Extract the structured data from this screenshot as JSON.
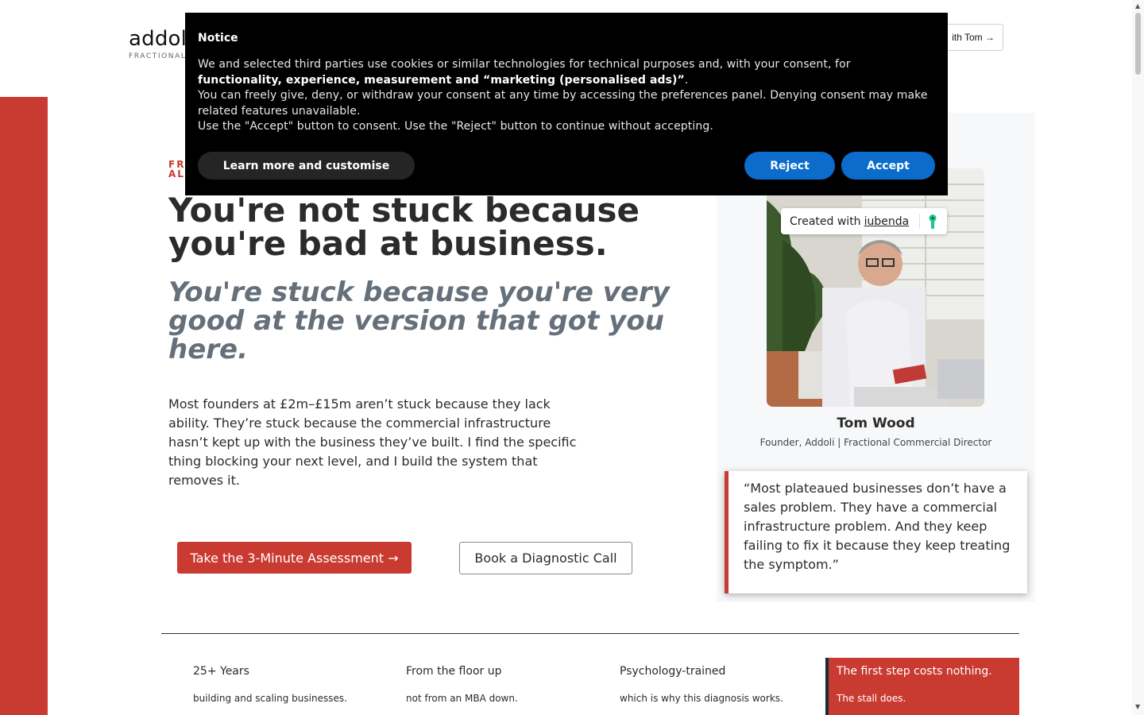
{
  "header": {
    "logo_text": "addoli",
    "logo_tagline": "FRACTIONAL COMMERCIAL DIRECTOR",
    "cta_label": "ith Tom →"
  },
  "hero": {
    "eyebrow_line1": "FR",
    "eyebrow_line2": "AL",
    "headline": "You're not stuck because you're bad at business.",
    "subheadline": "You're stuck because you're very good at the version that got you here.",
    "body": "Most founders at £2m–£15m aren’t stuck because they lack ability. They’re stuck because the commercial infrastructure hasn’t kept up with the business they’ve built. I find the specific thing blocking your next level, and I build the system that removes it.",
    "primary_cta": "Take the 3-Minute Assessment →",
    "secondary_cta": "Book a Diagnostic Call"
  },
  "profile": {
    "name": "Tom Wood",
    "role": "Founder, Addoli | Fractional Commercial Director",
    "quote": "“Most plateaued businesses don’t have a sales problem. They have a commercial infrastructure problem. And they keep failing to fix it because they keep treating the symptom.”"
  },
  "iubenda_badge": {
    "prefix": "Created with",
    "link": "iubenda"
  },
  "stats": [
    {
      "title": "25+ Years",
      "sub": "building and scaling businesses."
    },
    {
      "title": "From the floor up",
      "sub": "not from an MBA down."
    },
    {
      "title": "Psychology-trained",
      "sub": "which is why this diagnosis works."
    },
    {
      "title": "The first step costs nothing.",
      "sub": "The stall does."
    }
  ],
  "cookie": {
    "title": "Notice",
    "line1_prefix": "We and selected third parties use cookies or similar technologies for technical purposes and, with your consent, for ",
    "line1_bold": "functionality, experience, measurement and “marketing (personalised ads)”",
    "line1_suffix": ".",
    "line2": "You can freely give, deny, or withdraw your consent at any time by accessing the preferences panel. Denying consent may make related features unavailable.",
    "line3": "Use the \"Accept\" button to consent. Use the \"Reject\" button to continue without accepting.",
    "learn_more_label": "Learn more and customise",
    "reject_label": "Reject",
    "accept_label": "Accept"
  },
  "colors": {
    "brand_red": "#c93a31",
    "consent_blue": "#0b6ccc",
    "banner_bg": "#000000"
  }
}
